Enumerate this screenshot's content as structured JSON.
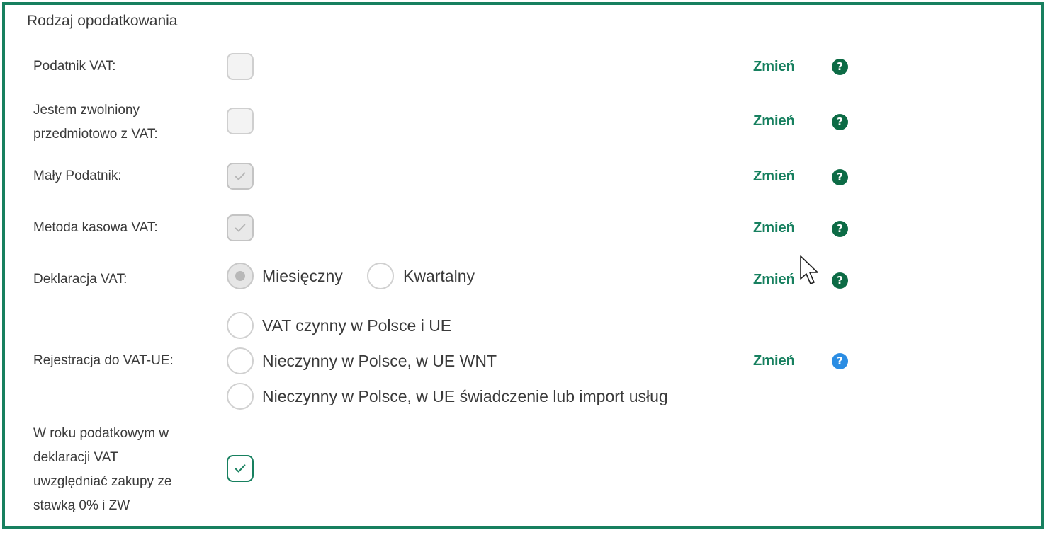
{
  "section": {
    "title": "Rodzaj opodatkowania"
  },
  "rows": {
    "vat_payer": {
      "label": "Podatnik VAT:",
      "checked": false
    },
    "exempt": {
      "label_line1": "Jestem zwolniony",
      "label_line2": "przedmiotowo z VAT:",
      "checked": false
    },
    "small_taxpayer": {
      "label": "Mały Podatnik:",
      "checked": true
    },
    "cash_method": {
      "label": "Metoda kasowa VAT:",
      "checked": true
    },
    "declaration": {
      "label": "Deklaracja VAT:",
      "options": [
        "Miesięczny",
        "Kwartalny"
      ],
      "selected": "Miesięczny"
    },
    "vat_ue": {
      "label": "Rejestracja do VAT-UE:",
      "options": [
        "VAT czynny w Polsce i UE",
        "Nieczynny w Polsce, w UE WNT",
        "Nieczynny w Polsce, w UE świadczenie lub import usług"
      ]
    },
    "zero_rate": {
      "label_lines": [
        "W roku podatkowym w",
        "deklaracji VAT",
        "uwzględniać zakupy ze",
        "stawką 0% i ZW"
      ],
      "checked": true
    }
  },
  "actions": {
    "change_label": "Zmień",
    "help_symbol": "?"
  },
  "icons": {
    "help": "help-circle-icon",
    "check": "checkmark-icon",
    "cursor": "mouse-pointer-icon"
  },
  "colors": {
    "accent": "#17805f",
    "help_dark": "#0c6b45",
    "help_active": "#2b8de3"
  }
}
